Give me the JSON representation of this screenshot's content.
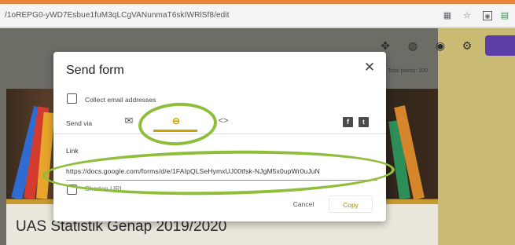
{
  "browser": {
    "url": "/1oREPG0-yWD7Esbue1fuM3qLCgVANunmaT6skIWRlSf8/edit"
  },
  "forms": {
    "total_points": "Total points: 100",
    "form_title": "UAS Statistik Genap 2019/2020"
  },
  "dialog": {
    "title": "Send form",
    "collect_email_label": "Collect email addresses",
    "send_via_label": "Send via",
    "link_label": "Link",
    "link_url": "https://docs.google.com/forms/d/e/1FAIpQLSeHymxUJ00tfsk-NJgM5x0upWr0uJuN",
    "shorten_url_label": "Shorten URL",
    "cancel_label": "Cancel",
    "copy_label": "Copy"
  },
  "icons": [
    "extensions-icon",
    "star-icon",
    "palette-icon",
    "eye-icon",
    "gear-icon",
    "email-icon",
    "link-icon",
    "embed-icon",
    "facebook-icon",
    "twitter-icon",
    "close-icon"
  ],
  "colors": {
    "accent": "#c9a100",
    "annotation": "#8fbe3b",
    "send_button": "#5b3ea8"
  }
}
